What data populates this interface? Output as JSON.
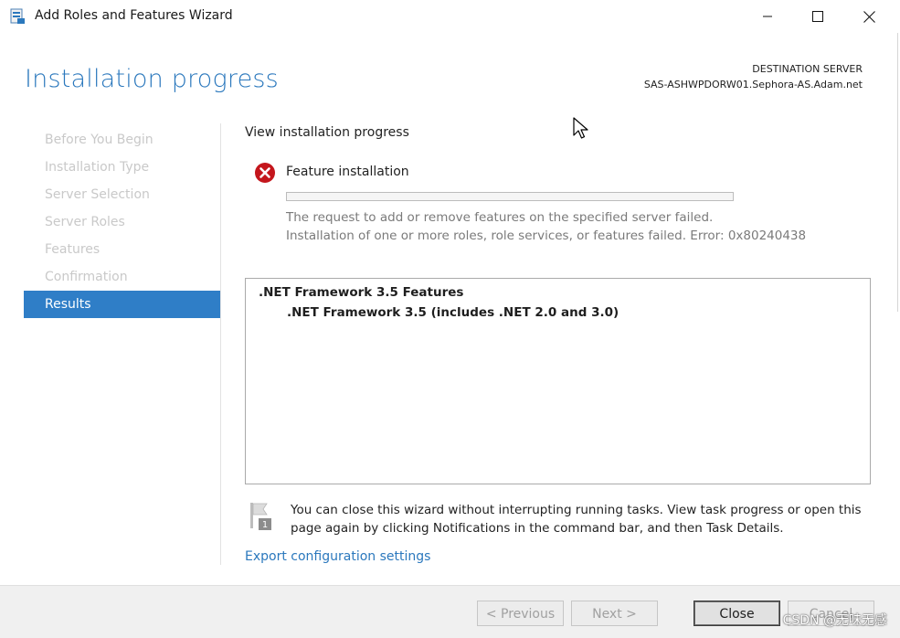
{
  "window": {
    "title": "Add Roles and Features Wizard",
    "app_icon": "server-manager-icon",
    "controls": [
      "minimize-icon",
      "maximize-icon",
      "close-icon"
    ]
  },
  "header": {
    "heading": "Installation progress",
    "destination_label": "DESTINATION SERVER",
    "destination_server": "SAS-ASHWPDORW01.Sephora-AS.Adam.net"
  },
  "nav": {
    "items": [
      {
        "label": "Before You Begin",
        "active": false
      },
      {
        "label": "Installation Type",
        "active": false
      },
      {
        "label": "Server Selection",
        "active": false
      },
      {
        "label": "Server Roles",
        "active": false
      },
      {
        "label": "Features",
        "active": false
      },
      {
        "label": "Confirmation",
        "active": false
      },
      {
        "label": "Results",
        "active": true
      }
    ]
  },
  "main": {
    "section_title": "View installation progress",
    "status_icon": "error-icon",
    "feature_label": "Feature installation",
    "progress": 0,
    "error_line1": "The request to add or remove features on the specified server failed.",
    "error_line2": "Installation of one or more roles, role services, or features failed. Error: 0x80240438",
    "results": {
      "parent": ".NET Framework 3.5 Features",
      "child": ".NET Framework 3.5 (includes .NET 2.0 and 3.0)"
    },
    "note_icon": "notification-flag-icon",
    "note": "You can close this wizard without interrupting running tasks. View task progress or open this page again by clicking Notifications in the command bar, and then Task Details.",
    "export_link": "Export configuration settings"
  },
  "footer": {
    "previous_label": "< Previous",
    "next_label": "Next >",
    "close_label": "Close",
    "cancel_label": "Cancel"
  },
  "watermark": "CSDN @无味无感",
  "colors": {
    "accent": "#2b78bd",
    "nav_active": "#2f7ec7",
    "error": "#c4161c"
  }
}
